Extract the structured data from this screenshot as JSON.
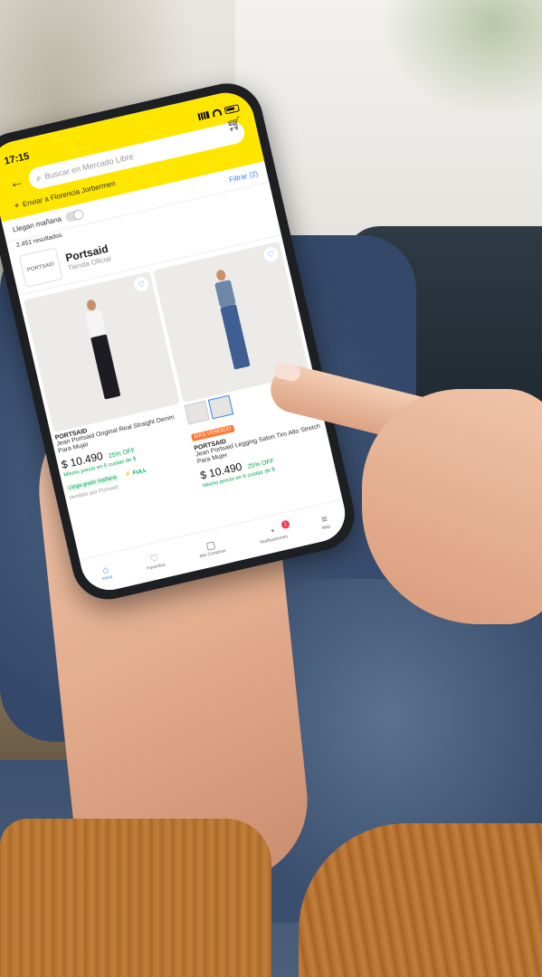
{
  "status_bar": {
    "time": "17:15"
  },
  "header": {
    "search_placeholder": "Buscar en Mercado Libre",
    "location": "Enviar a Florencia Jorbermen"
  },
  "filters": {
    "toggle_label": "Llegan mañana",
    "filter_link": "Filtrar (2)",
    "results_count": "2.451 resultados"
  },
  "store": {
    "logo_text": "PORTSAID",
    "name": "Portsaid",
    "subtitle": "Tienda Oficial"
  },
  "products": [
    {
      "brand": "PORTSAID",
      "title": "Jean Portsaid Original Real Straight Denim Para Mujer",
      "price": "$ 10.490",
      "discount": "25% OFF",
      "installments": "Mismo precio en 6 cuotas de $",
      "shipping": "Llega gratis mañana",
      "full": "⚡ FULL",
      "seller": "Vendido por Portsaid"
    },
    {
      "tag": "MÁS VENDIDO",
      "brand": "PORTSAID",
      "title": "Jean Portsaid Legging Satori Tiro Alto Stretch Para Mujer",
      "price": "$ 10.490",
      "discount": "25% OFF",
      "installments": "Mismo precio en 6 cuotas de $"
    }
  ],
  "nav": {
    "items": [
      {
        "label": "Inicio",
        "icon": "home-icon"
      },
      {
        "label": "Favoritos",
        "icon": "heart-icon"
      },
      {
        "label": "Mis Compras",
        "icon": "bag-icon"
      },
      {
        "label": "Notificaciones",
        "icon": "bell-icon",
        "badge": "1"
      },
      {
        "label": "Más",
        "icon": "menu-icon"
      }
    ]
  },
  "colors": {
    "brand_yellow": "#ffe600",
    "link_blue": "#3483fa",
    "green": "#00a650"
  }
}
